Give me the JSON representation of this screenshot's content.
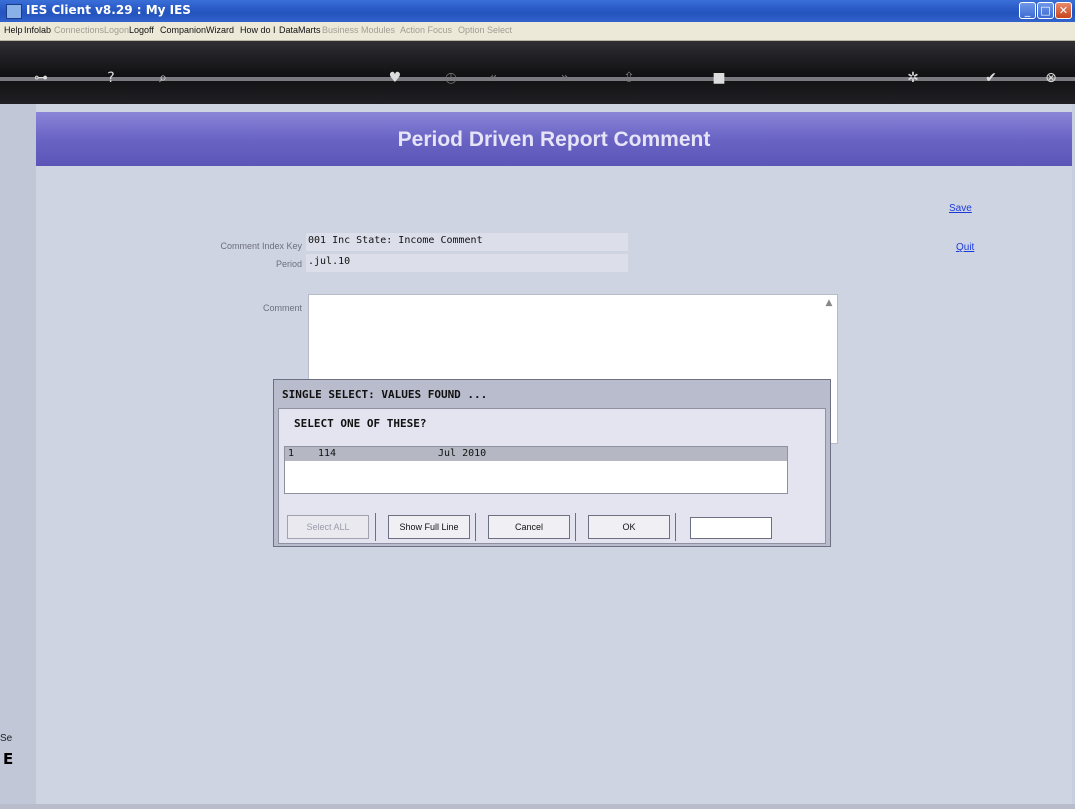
{
  "window": {
    "title": "IES Client v8.29 : My IES",
    "icon": "app-icon",
    "controls": [
      "minimize-icon",
      "maximize-icon",
      "close-icon"
    ]
  },
  "menu": {
    "items": [
      {
        "label": "Help",
        "enabled": true
      },
      {
        "label": "Infolab",
        "enabled": true
      },
      {
        "label": "Connections",
        "enabled": false
      },
      {
        "label": "Logon",
        "enabled": false
      },
      {
        "label": "Logoff",
        "enabled": true
      },
      {
        "label": "Companion",
        "enabled": true
      },
      {
        "label": "Wizard",
        "enabled": true
      },
      {
        "label": "How do I",
        "enabled": true
      },
      {
        "label": "DataMarts",
        "enabled": true
      },
      {
        "label": "Business Modules",
        "enabled": false
      },
      {
        "label": "Action Focus",
        "enabled": false
      },
      {
        "label": "Option Select",
        "enabled": false
      }
    ]
  },
  "toolbar": {
    "icons": [
      "key-icon",
      "help-icon",
      "search-icon",
      "heart-icon",
      "clock-icon",
      "rewind-icon",
      "fast-forward-icon",
      "upload-icon",
      "stop-icon",
      "options-icon",
      "check-icon",
      "close-icon"
    ]
  },
  "page": {
    "title": "Period Driven Report Comment",
    "links": {
      "save": "Save",
      "quit": "Quit"
    },
    "fields": {
      "comment_index_key_label": "Comment Index Key",
      "comment_index_key_value": "001 Inc State: Income Comment",
      "period_label": "Period",
      "period_value": ".jul.10",
      "comment_label": "Comment"
    },
    "left_text": "Se",
    "left_text2": "E"
  },
  "dialog": {
    "title": "SINGLE SELECT: VALUES FOUND ...",
    "prompt": "SELECT ONE OF THESE?",
    "rows": [
      {
        "col1": "1",
        "col2": "114",
        "col3": "Jul 2010"
      }
    ],
    "buttons": {
      "select_all": "Select ALL",
      "show_full_line": "Show Full Line",
      "cancel": "Cancel",
      "ok": "OK"
    }
  },
  "colors": {
    "header_gradient": "#6a64c4",
    "link": "#1b3bd9",
    "titlebar": "#2a5ac6"
  }
}
